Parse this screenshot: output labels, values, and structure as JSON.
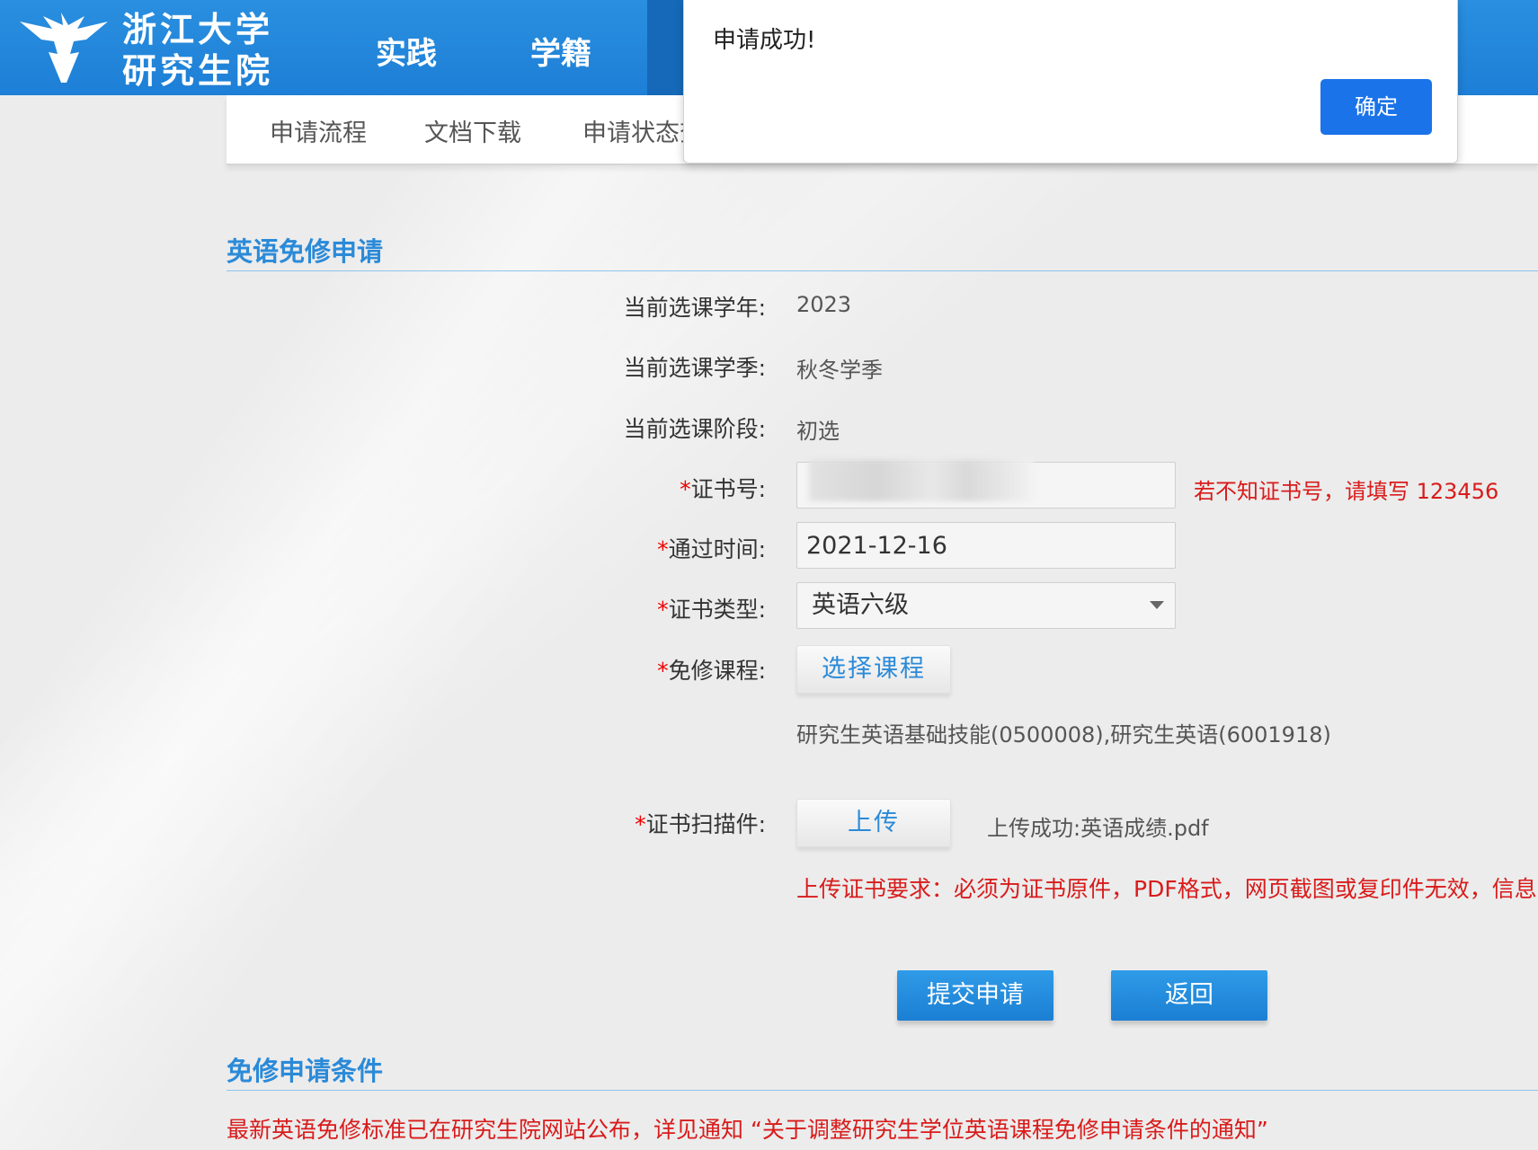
{
  "header": {
    "logo_line1": "浙江大学",
    "logo_line2": "研究生院",
    "nav": [
      "实践",
      "学籍"
    ]
  },
  "subnav": [
    "申请流程",
    "文档下载",
    "申请状态查"
  ],
  "modal": {
    "message": "申请成功!",
    "ok_label": "确定"
  },
  "section1": {
    "title": "英语免修申请"
  },
  "form": {
    "year": {
      "label": "当前选课学年:",
      "value": "2023"
    },
    "season": {
      "label": "当前选课学季:",
      "value": "秋冬学季"
    },
    "stage": {
      "label": "当前选课阶段:",
      "value": "初选"
    },
    "cert_no": {
      "star": "*",
      "label": "证书号:",
      "value": "",
      "hint": "若不知证书号，请填写 123456"
    },
    "pass_time": {
      "star": "*",
      "label": "通过时间:",
      "value": "2021-12-16"
    },
    "cert_type": {
      "star": "*",
      "label": "证书类型:",
      "value": "英语六级"
    },
    "course": {
      "star": "*",
      "label": "免修课程:",
      "button": "选择课程",
      "selected": "研究生英语基础技能(0500008),研究生英语(6001918)"
    },
    "scan": {
      "star": "*",
      "label": "证书扫描件:",
      "button": "上传",
      "status": "上传成功:英语成绩.pdf",
      "requirement": "上传证书要求：必须为证书原件，PDF格式，网页截图或复印件无效，信息"
    }
  },
  "actions": {
    "submit": "提交申请",
    "back": "返回"
  },
  "section2": {
    "title": "免修申请条件",
    "notice": "最新英语免修标准已在研究生院网站公布，详见通知 “关于调整研究生学位英语课程免修申请条件的通知”"
  },
  "colors": {
    "brand_blue": "#1d7fd6",
    "accent_text": "#2b8ad8",
    "warning_red": "#d91b1b",
    "modal_button": "#1a73e8"
  }
}
